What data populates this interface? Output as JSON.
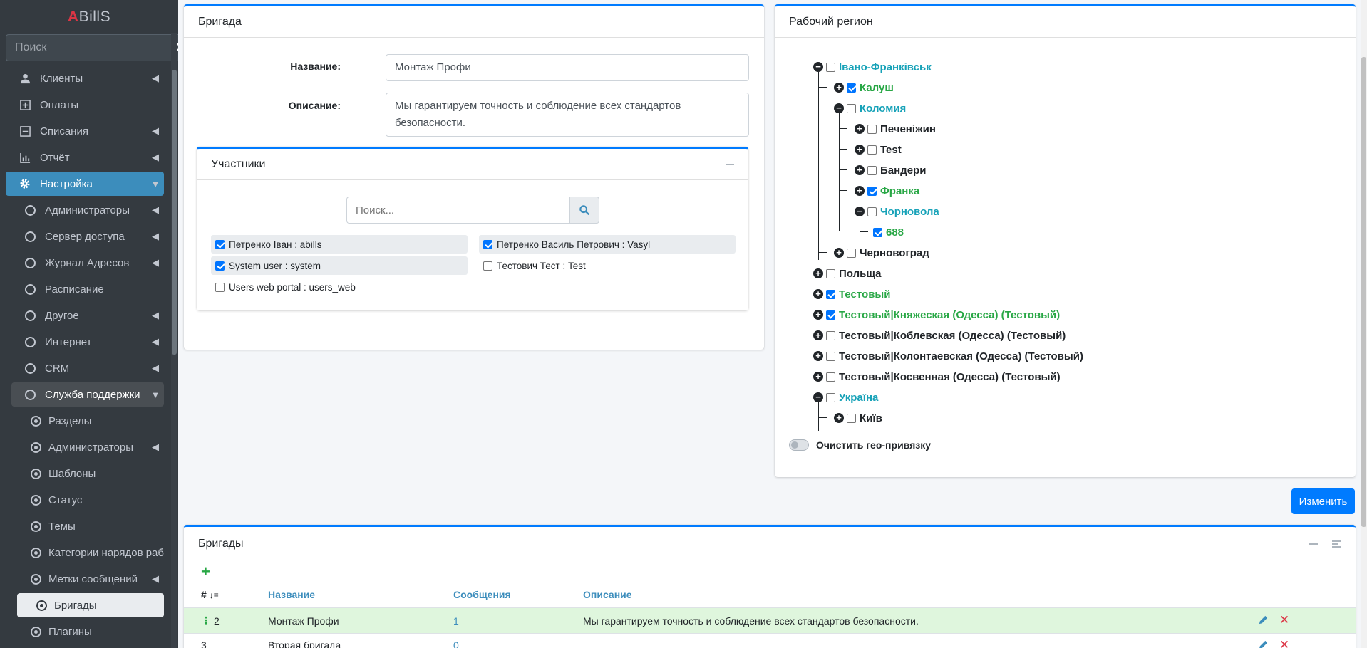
{
  "sidebar": {
    "brand_accent": "A",
    "brand_rest": "BillS",
    "search_placeholder": "Поиск",
    "items": [
      {
        "label": "Клиенты"
      },
      {
        "label": "Оплаты"
      },
      {
        "label": "Списания"
      },
      {
        "label": "Отчёт"
      },
      {
        "label": "Настройка"
      },
      {
        "label": "Администраторы"
      },
      {
        "label": "Сервер доступа"
      },
      {
        "label": "Журнал Адресов"
      },
      {
        "label": "Расписание"
      },
      {
        "label": "Другое"
      },
      {
        "label": "Интернет"
      },
      {
        "label": "CRM"
      },
      {
        "label": "Служба поддержки"
      },
      {
        "label": "Разделы"
      },
      {
        "label": "Администраторы"
      },
      {
        "label": "Шаблоны"
      },
      {
        "label": "Статус"
      },
      {
        "label": "Темы"
      },
      {
        "label": "Категории нарядов работ"
      },
      {
        "label": "Метки сообщений"
      },
      {
        "label": "Бригады"
      },
      {
        "label": "Плагины"
      }
    ]
  },
  "brigade_card": {
    "title": "Бригада",
    "name_label": "Название:",
    "name_value": "Монтаж Профи",
    "desc_label": "Описание:",
    "desc_value": "Мы гарантируем точность и соблюдение всех стандартов безопасности.",
    "participants": {
      "title": "Участники",
      "search_placeholder": "Поиск...",
      "users": [
        {
          "label": "Петренко Іван : abills",
          "checked": true
        },
        {
          "label": "Петренко Василь Петрович : Vasyl",
          "checked": true
        },
        {
          "label": "System user : system",
          "checked": true
        },
        {
          "label": "Тестович Тест : Test",
          "checked": false
        },
        {
          "label": "Users web portal : users_web",
          "checked": false
        }
      ]
    }
  },
  "region_card": {
    "title": "Рабочий регион",
    "tree": [
      {
        "label": "Івано-Франківськ",
        "checked": false,
        "state": "open",
        "color": "#17a2b8"
      },
      {
        "label": "Калуш",
        "checked": true,
        "state": "closed",
        "color": "#28a745"
      },
      {
        "label": "Коломия",
        "checked": false,
        "state": "open",
        "color": "#17a2b8"
      },
      {
        "label": "Печеніжин",
        "checked": false,
        "state": "closed",
        "color": "#212529"
      },
      {
        "label": "Test",
        "checked": false,
        "state": "closed",
        "color": "#212529"
      },
      {
        "label": "Бандери",
        "checked": false,
        "state": "closed",
        "color": "#212529"
      },
      {
        "label": "Франка",
        "checked": true,
        "state": "closed",
        "color": "#28a745"
      },
      {
        "label": "Чорновола",
        "checked": false,
        "state": "open",
        "color": "#17a2b8"
      },
      {
        "label": "688",
        "checked": true,
        "state": "leaf",
        "color": "#28a745"
      },
      {
        "label": "Черновоград",
        "checked": false,
        "state": "closed",
        "color": "#212529"
      },
      {
        "label": "Польща",
        "checked": false,
        "state": "closed",
        "color": "#212529"
      },
      {
        "label": "Тестовый",
        "checked": true,
        "state": "closed",
        "color": "#28a745"
      },
      {
        "label": "Тестовый|Княжеская (Одесса) (Тестовый)",
        "checked": true,
        "state": "closed",
        "color": "#28a745"
      },
      {
        "label": "Тестовый|Коблевская (Одесса) (Тестовый)",
        "checked": false,
        "state": "closed",
        "color": "#212529"
      },
      {
        "label": "Тестовый|Колонтаевская (Одесса) (Тестовый)",
        "checked": false,
        "state": "closed",
        "color": "#212529"
      },
      {
        "label": "Тестовый|Косвенная (Одесса) (Тестовый)",
        "checked": false,
        "state": "closed",
        "color": "#212529"
      },
      {
        "label": "Україна",
        "checked": false,
        "state": "open",
        "color": "#17a2b8"
      },
      {
        "label": "Київ",
        "checked": false,
        "state": "closed",
        "color": "#212529"
      }
    ],
    "clear_geo_label": "Очистить гео-привязку",
    "clear_geo_on": false
  },
  "change_button": "Изменить",
  "brigades_table": {
    "title": "Бригады",
    "add_symbol": "+",
    "columns": {
      "id": "#",
      "name": "Название",
      "messages": "Сообщения",
      "description": "Описание"
    },
    "rows": [
      {
        "id": "2",
        "name": "Монтаж Профи",
        "messages": "1",
        "description": "Мы гарантируем точность и соблюдение всех стандартов безопасности."
      },
      {
        "id": "3",
        "name": "Вторая бригада",
        "messages": "0",
        "description": ""
      }
    ]
  },
  "colors": {
    "primary": "#007bff",
    "sidebar_bg": "#343a40",
    "sidebar_active": "#3c8dbc",
    "checked_green": "#28a745",
    "link_blue": "#17a2b8",
    "row_highlight": "#dff6dd",
    "delete_red": "#dc3545"
  }
}
